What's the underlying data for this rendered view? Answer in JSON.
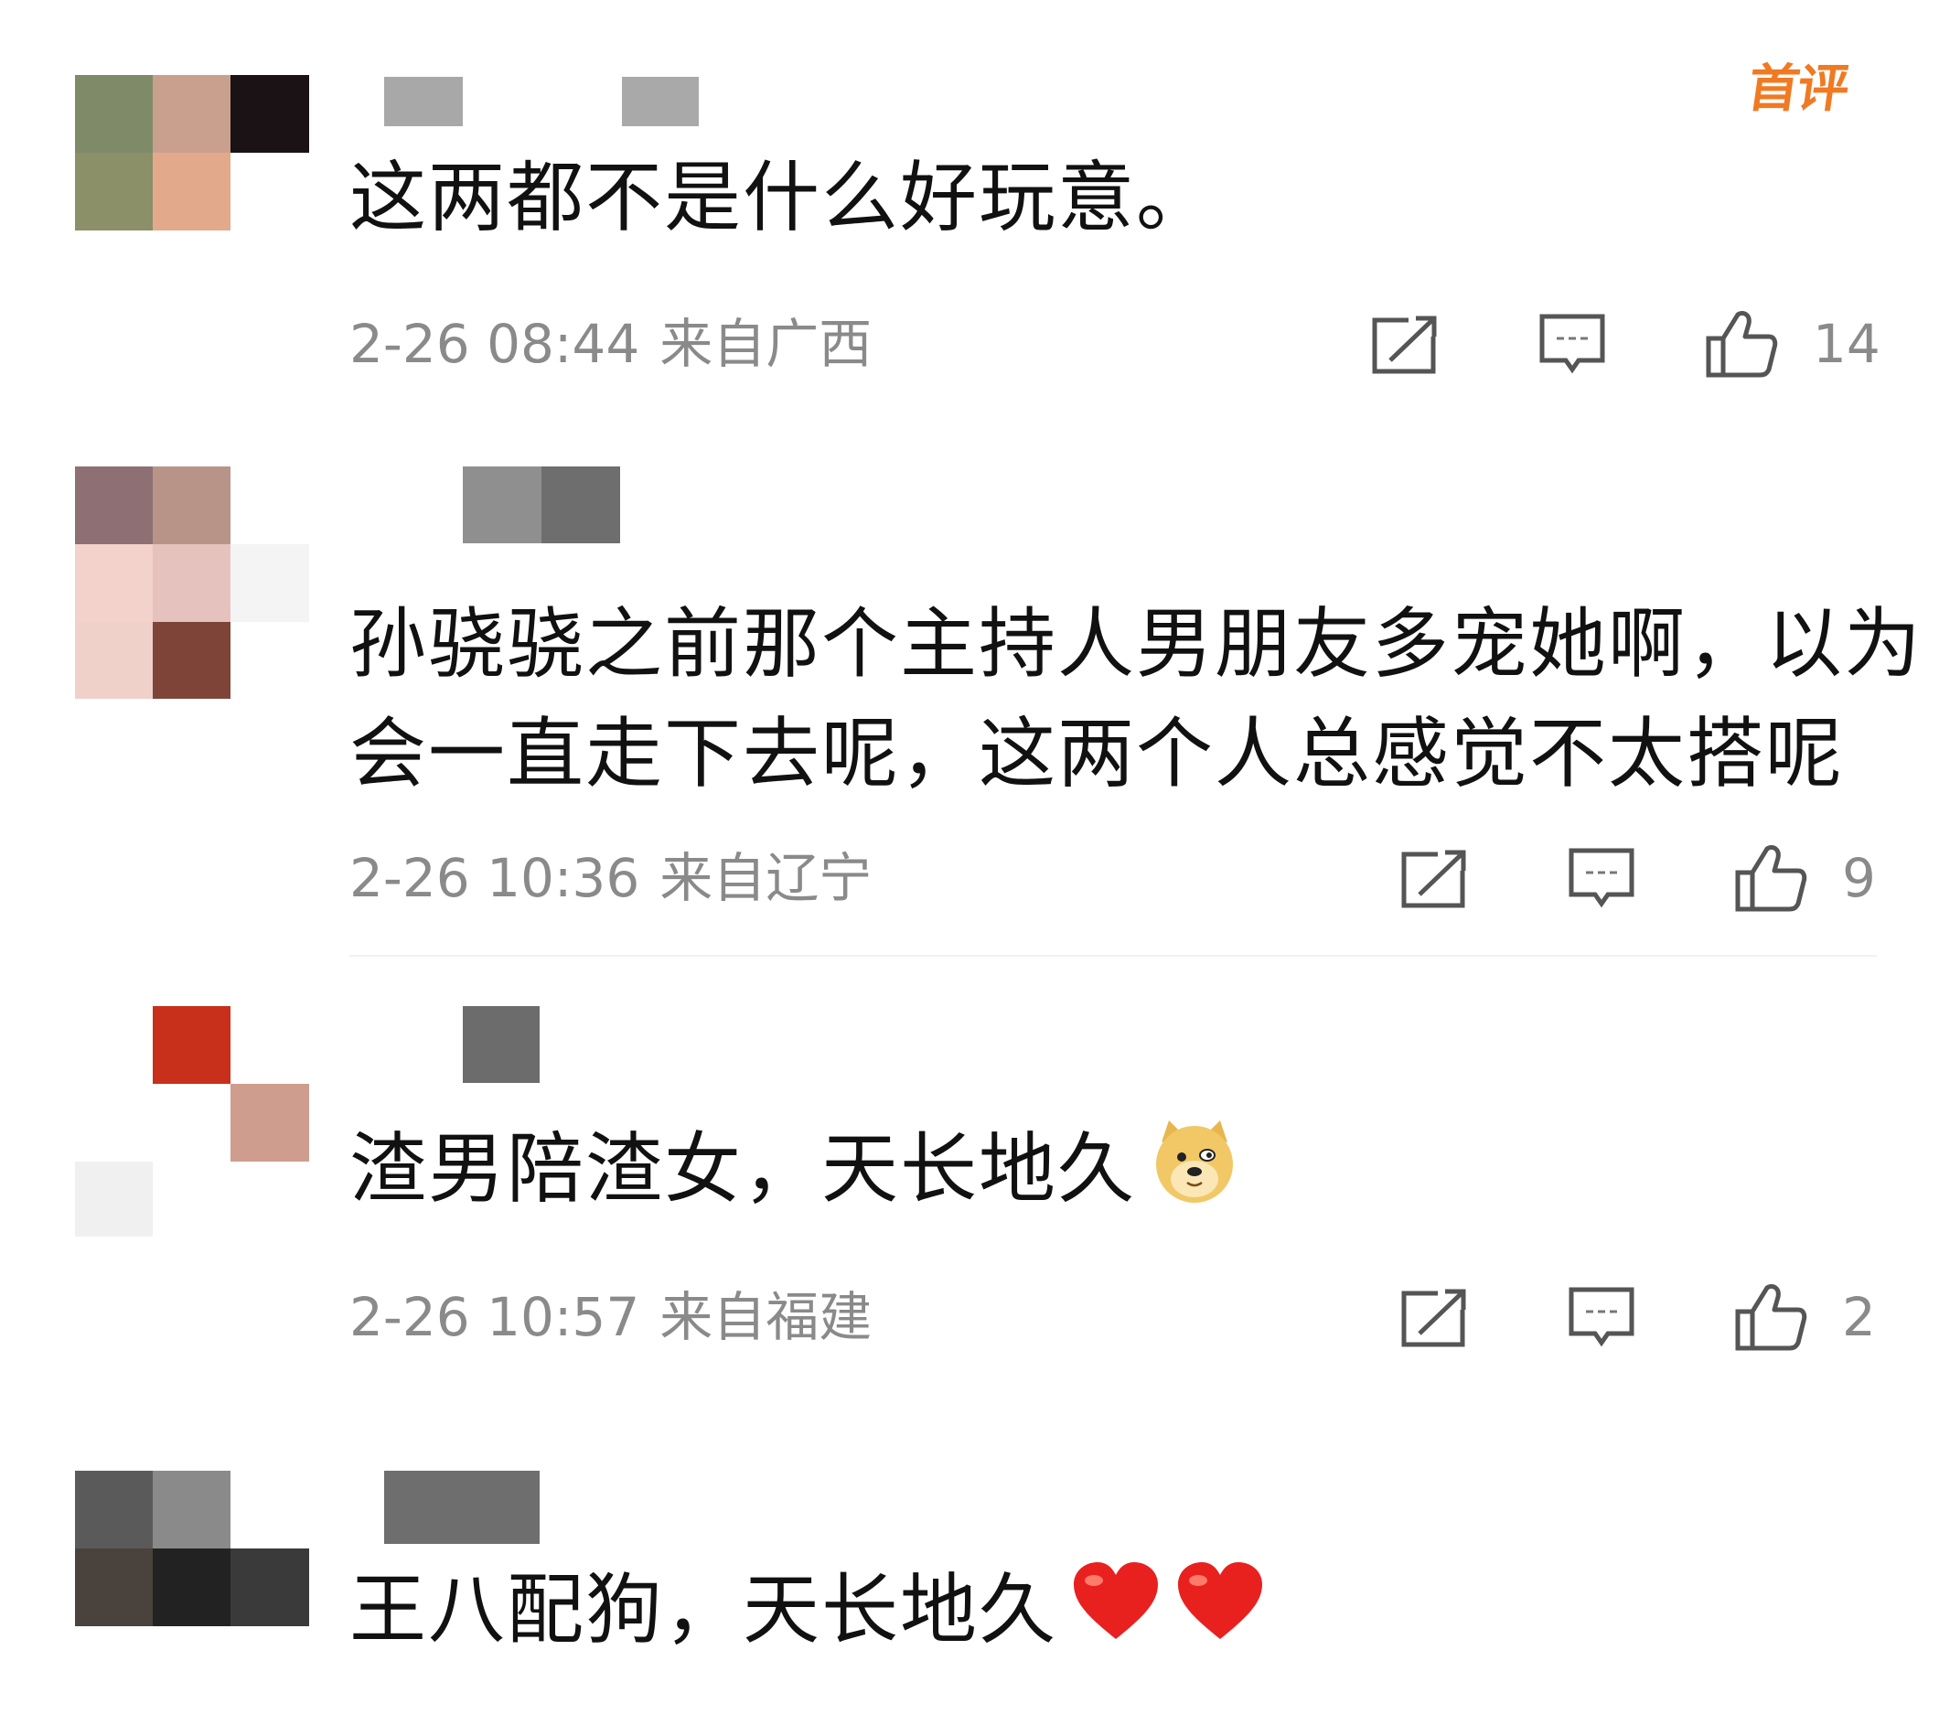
{
  "badge": {
    "first_comment": "首评"
  },
  "colors": {
    "meta_gray": "#8a8a8a",
    "text": "#111111",
    "badge_orange": "#f07a22",
    "heart_red": "#e8211f"
  },
  "icons": {
    "share": "share-icon",
    "reply": "comment-icon",
    "like": "thumbs-up-icon",
    "doge": "doge-emoji",
    "heart": "red-heart-emoji"
  },
  "comments": [
    {
      "text": "这两都不是什么好玩意。",
      "time": "2-26 08:44",
      "location": "来自广西",
      "likes": "14"
    },
    {
      "text_lines": [
        "孙骁骁之前那个主持人男朋友多宠她啊，以为",
        "会一直走下去呢，这两个人总感觉不太搭呢"
      ],
      "time": "2-26 10:36",
      "location": "来自辽宁",
      "likes": "9"
    },
    {
      "text": "渣男陪渣女，天长地久",
      "time": "2-26 10:57",
      "location": "来自福建",
      "likes": "2"
    },
    {
      "text": "王八配狗，天长地久"
    }
  ]
}
